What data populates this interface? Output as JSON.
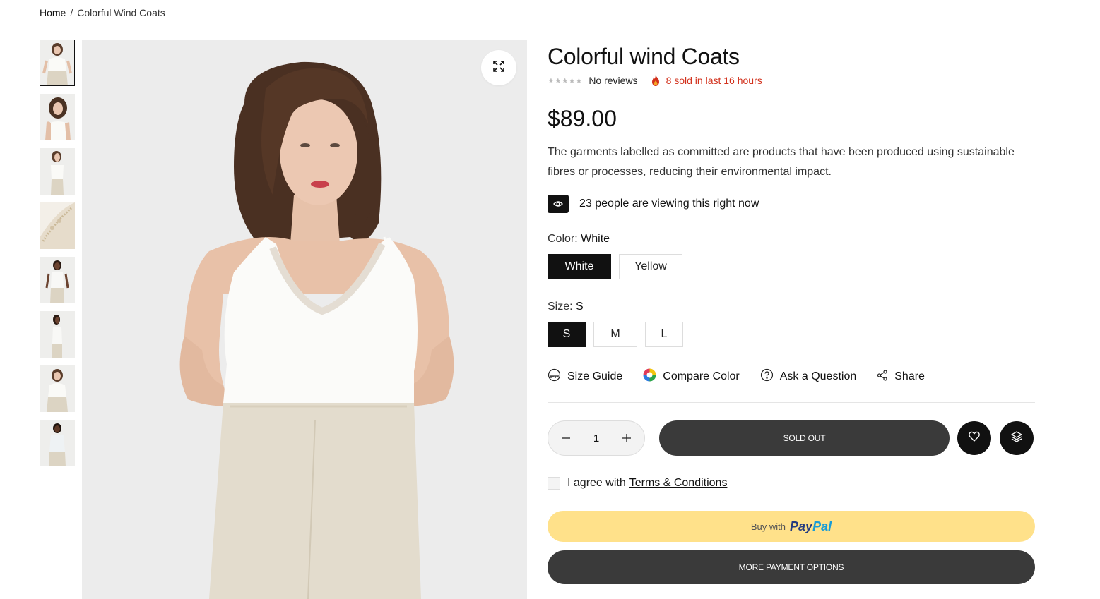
{
  "breadcrumb": {
    "home": "Home",
    "separator": "/",
    "current": "Colorful Wind Coats"
  },
  "gallery": {
    "thumbnail_count": 8,
    "zoom_icon": "expand-icon"
  },
  "product": {
    "title": "Colorful wind Coats",
    "stars": "★★★★★",
    "reviews": "No reviews",
    "sold_text": "8 sold in last 16 hours",
    "price": "$89.00",
    "description": "The garments labelled as committed are products that have been produced using sustainable fibres or processes, reducing their environmental impact.",
    "viewing_text": "23 people are viewing this right now"
  },
  "color": {
    "label": "Color:",
    "selected": "White",
    "options": [
      "White",
      "Yellow"
    ]
  },
  "size": {
    "label": "Size:",
    "selected": "S",
    "options": [
      "S",
      "M",
      "L"
    ]
  },
  "links": {
    "size_guide": "Size Guide",
    "compare_color": "Compare Color",
    "ask_question": "Ask a Question",
    "share": "Share"
  },
  "cart": {
    "quantity": "1",
    "sold_out": "SOLD OUT"
  },
  "terms": {
    "prefix": "I agree with",
    "link": "Terms & Conditions"
  },
  "payment": {
    "buy_with": "Buy with",
    "paypal_1": "Pay",
    "paypal_2": "Pal",
    "more_options": "MORE PAYMENT OPTIONS"
  },
  "colors": {
    "accent_dark": "#111111",
    "sold_red": "#d2311c",
    "paypal_yellow": "#ffe18a",
    "button_gray": "#3a3a3a"
  }
}
